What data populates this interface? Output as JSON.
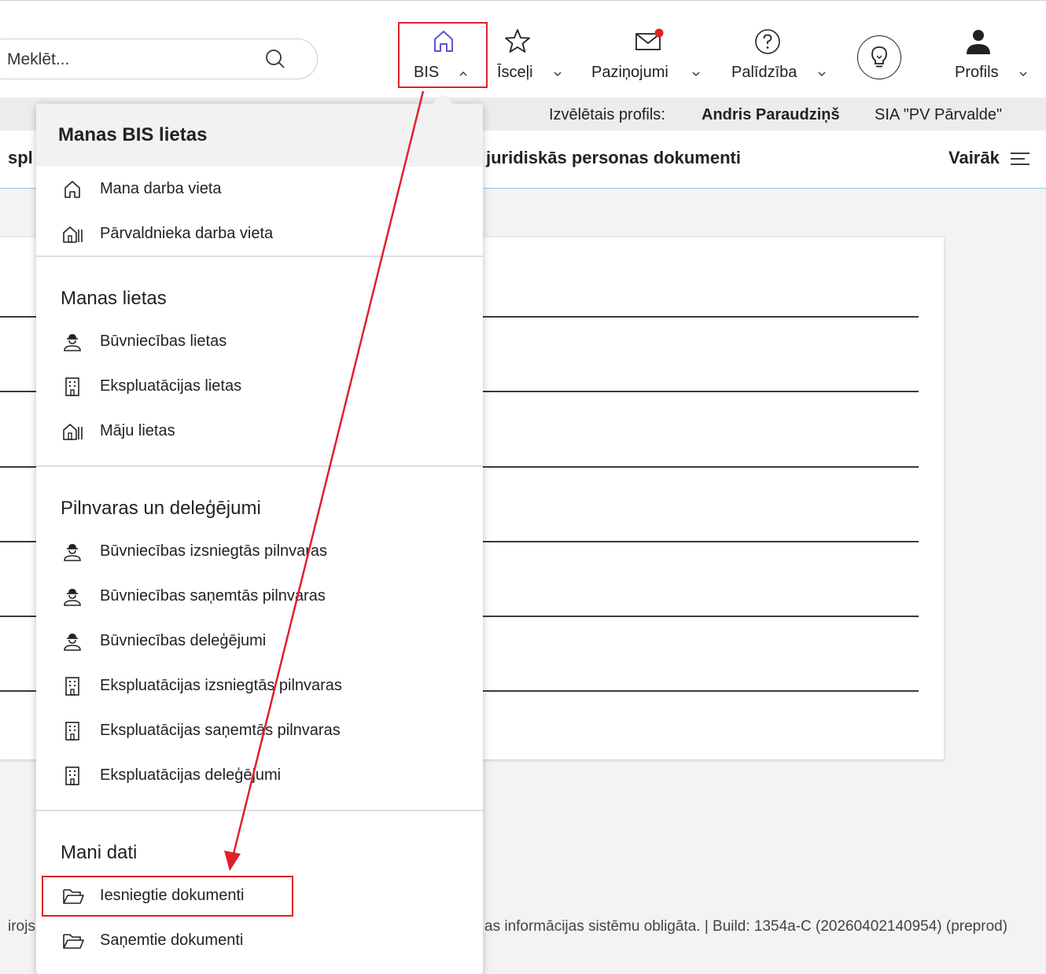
{
  "search": {
    "placeholder": "Meklēt..."
  },
  "nav": {
    "bis": "BIS",
    "shortcuts": "Īsceļi",
    "notifications": "Paziņojumi",
    "help": "Palīdzība",
    "profile": "Profils"
  },
  "profile_bar": {
    "label": "Izvēlētais profils:",
    "user": "Andris Paraudziņš",
    "company": "SIA \"PV Pārvalde\""
  },
  "tabs": {
    "left_partial": "spl",
    "docs": "juridiskās personas dokumenti",
    "more": "Vairāk"
  },
  "footer": {
    "left_partial": "irojs",
    "right": "as informācijas sistēmu obligāta. | Build: 1354a-C (20260402140954) (preprod)"
  },
  "menu": {
    "title": "Manas BIS lietas",
    "workplace": [
      {
        "label": "Mana darba vieta",
        "icon": "home-icon"
      },
      {
        "label": "Pārvaldnieka darba vieta",
        "icon": "houses-icon"
      }
    ],
    "my_cases_title": "Manas lietas",
    "my_cases": [
      {
        "label": "Būvniecības lietas",
        "icon": "builder-icon"
      },
      {
        "label": "Ekspluatācijas lietas",
        "icon": "building-icon"
      },
      {
        "label": "Māju lietas",
        "icon": "houses-icon"
      }
    ],
    "powers_title": "Pilnvaras un deleģējumi",
    "powers": [
      {
        "label": "Būvniecības izsniegtās pilnvaras",
        "icon": "builder-icon"
      },
      {
        "label": "Būvniecības saņemtās pilnvaras",
        "icon": "builder-icon"
      },
      {
        "label": "Būvniecības deleģējumi",
        "icon": "builder-icon"
      },
      {
        "label": "Ekspluatācijas izsniegtās pilnvaras",
        "icon": "building-icon"
      },
      {
        "label": "Ekspluatācijas saņemtās pilnvaras",
        "icon": "building-icon"
      },
      {
        "label": "Ekspluatācijas deleģējumi",
        "icon": "building-icon"
      }
    ],
    "data_title": "Mani dati",
    "data": [
      {
        "label": "Iesniegtie dokumenti",
        "icon": "folder-icon"
      },
      {
        "label": "Saņemtie dokumenti",
        "icon": "folder-icon"
      }
    ]
  },
  "colors": {
    "annotation": "#e0202a",
    "accent": "#8fd0e6",
    "notification_dot": "#e0202a"
  }
}
